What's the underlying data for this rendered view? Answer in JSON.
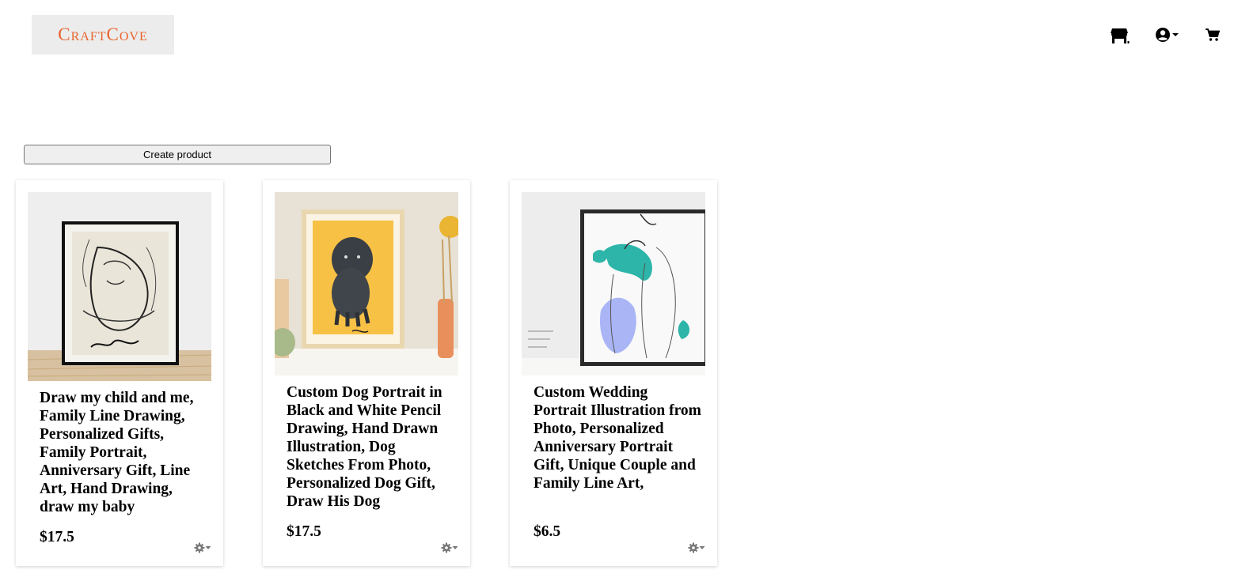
{
  "brand": {
    "logo_text": "CraftCove"
  },
  "header": {
    "icons": [
      "store-icon",
      "account-icon",
      "cart-icon"
    ]
  },
  "actions": {
    "create_product_label": "Create product"
  },
  "products": [
    {
      "title": "Draw my child and me, Family Line Drawing, Personalized Gifts, Family Portrait, Anniversary Gift, Line Art, Hand Drawing, draw my baby",
      "price": "$17.5",
      "image": "family-line-drawing-image"
    },
    {
      "title": "Custom Dog Portrait in Black and White Pencil Drawing, Hand Drawn Illustration, Dog Sketches From Photo, Personalized Dog Gift, Draw His Dog",
      "price": "$17.5",
      "image": "dog-portrait-image"
    },
    {
      "title": "Custom Wedding Portrait Illustration from Photo, Personalized Anniversary Portrait Gift, Unique Couple and Family Line Art,",
      "price": "$6.5",
      "image": "wedding-portrait-image"
    }
  ],
  "colors": {
    "logo": "#e8632b",
    "logo_bg": "#ececec",
    "gear": "#777777",
    "dog_bg": "#f7c145",
    "wedding_teal": "#2cb5a8",
    "wedding_lilac": "#a9b5f5"
  }
}
